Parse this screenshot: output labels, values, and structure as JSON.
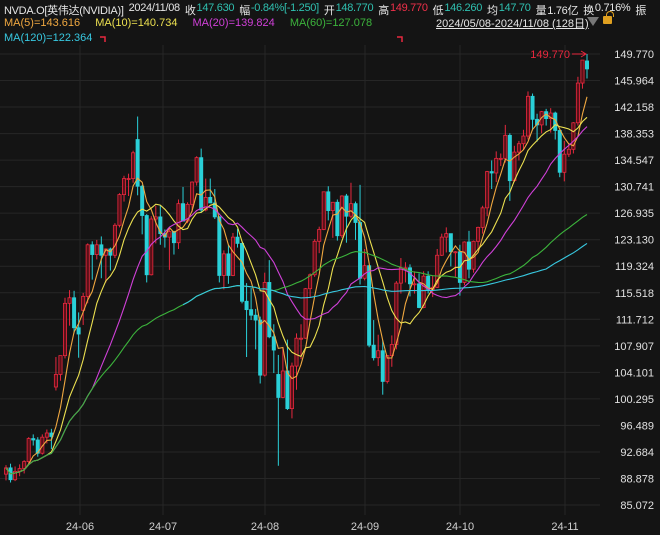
{
  "header": {
    "symbol": "NVDA.O[英伟达(NVIDIA)]",
    "date": "2024/11/08",
    "close_label": "收",
    "close": "147.630",
    "change_label": "幅",
    "change": "-0.84%[-1.250]",
    "open_label": "开",
    "open": "148.770",
    "high_label": "高",
    "high": "149.770",
    "low_label": "低",
    "low": "146.260",
    "avg_label": "均",
    "avg": "147.70",
    "volume_label": "量",
    "volume": "1.76亿",
    "turnover_label": "换",
    "turnover": "0.716%",
    "amplitude_label": "振",
    "range": "2024/05/08-2024/11/08 (128日)",
    "icons": {
      "dropdown": "triangle-down-icon",
      "lock": "unlock-icon"
    }
  },
  "ma_legend": {
    "ma5": "MA(5)=143.616",
    "ma10": "MA(10)=140.734",
    "ma20": "MA(20)=139.824",
    "ma60": "MA(60)=127.078",
    "ma120": "MA(120)=122.364"
  },
  "colors": {
    "up": "#e8283e",
    "down": "#2ad0d8",
    "ma5": "#f0a840",
    "ma10": "#ece050",
    "ma20": "#d040d8",
    "ma60": "#3cb43c",
    "ma120": "#38c8e0",
    "background": "#141414"
  },
  "chart_data": {
    "type": "candlestick",
    "x_tick_labels": [
      "24-06",
      "24-07",
      "24-08",
      "24-09",
      "24-10",
      "24-11"
    ],
    "y_tick_labels": [
      "149.770",
      "145.964",
      "142.158",
      "138.353",
      "134.547",
      "130.741",
      "126.935",
      "123.130",
      "119.324",
      "115.518",
      "111.712",
      "107.907",
      "104.101",
      "100.295",
      "96.489",
      "92.684",
      "88.878",
      "85.072"
    ],
    "ylim": [
      85.072,
      149.77
    ],
    "max_annotation": "149.770",
    "ma_periods": [
      5,
      10,
      20,
      60,
      120
    ],
    "candles_ohlc": [
      [
        89.5,
        90.8,
        88.6,
        90.4
      ],
      [
        90.4,
        91.0,
        88.3,
        88.7
      ],
      [
        88.7,
        90.6,
        88.5,
        89.9
      ],
      [
        89.9,
        90.9,
        89.2,
        90.3
      ],
      [
        90.3,
        91.5,
        89.6,
        91.3
      ],
      [
        91.3,
        94.8,
        91.0,
        94.6
      ],
      [
        94.6,
        95.2,
        93.6,
        94.4
      ],
      [
        94.4,
        94.8,
        92.0,
        92.5
      ],
      [
        92.5,
        95.2,
        92.3,
        94.8
      ],
      [
        94.8,
        95.9,
        93.9,
        95.4
      ],
      [
        95.4,
        96.0,
        93.1,
        94.9
      ],
      [
        102.0,
        106.3,
        101.5,
        103.8
      ],
      [
        103.8,
        106.5,
        102.9,
        106.5
      ],
      [
        106.5,
        114.8,
        106.1,
        114.0
      ],
      [
        114.0,
        115.9,
        110.8,
        114.8
      ],
      [
        114.8,
        115.8,
        109.7,
        110.5
      ],
      [
        110.5,
        112.7,
        106.2,
        109.6
      ],
      [
        113.0,
        115.5,
        110.9,
        115.0
      ],
      [
        115.0,
        122.6,
        114.0,
        122.4
      ],
      [
        122.4,
        122.9,
        117.4,
        121.0
      ],
      [
        121.0,
        123.1,
        120.3,
        122.4
      ],
      [
        122.4,
        123.6,
        117.6,
        120.9
      ],
      [
        120.9,
        121.9,
        117.0,
        121.8
      ],
      [
        121.8,
        122.0,
        118.7,
        120.9
      ],
      [
        120.9,
        125.5,
        120.5,
        125.2
      ],
      [
        125.2,
        129.8,
        124.9,
        129.6
      ],
      [
        129.6,
        132.3,
        128.6,
        131.9
      ],
      [
        131.9,
        132.6,
        129.4,
        131.9
      ],
      [
        131.9,
        135.9,
        131.3,
        135.6
      ],
      [
        137.5,
        140.8,
        129.5,
        130.8
      ],
      [
        130.8,
        131.0,
        123.9,
        126.6
      ],
      [
        126.6,
        126.8,
        117.0,
        118.1
      ],
      [
        118.1,
        126.5,
        118.0,
        126.1
      ],
      [
        126.1,
        128.0,
        122.6,
        126.4
      ],
      [
        126.4,
        128.1,
        122.4,
        124.0
      ],
      [
        124.0,
        124.6,
        122.0,
        123.5
      ],
      [
        123.5,
        124.8,
        118.8,
        124.3
      ],
      [
        124.3,
        124.4,
        121.0,
        122.7
      ],
      [
        122.7,
        128.9,
        121.8,
        128.3
      ],
      [
        128.3,
        130.7,
        125.8,
        125.8
      ],
      [
        125.8,
        128.5,
        125.5,
        128.2
      ],
      [
        128.2,
        131.5,
        127.1,
        131.4
      ],
      [
        131.4,
        135.1,
        130.9,
        134.9
      ],
      [
        134.9,
        136.2,
        127.0,
        127.4
      ],
      [
        127.4,
        131.9,
        127.2,
        129.2
      ],
      [
        129.2,
        131.9,
        128.7,
        128.4
      ],
      [
        128.4,
        130.4,
        126.1,
        126.4
      ],
      [
        126.4,
        126.5,
        117.0,
        118.0
      ],
      [
        118.0,
        121.6,
        116.0,
        121.1
      ],
      [
        121.1,
        122.4,
        116.8,
        118.0
      ],
      [
        118.0,
        124.1,
        117.9,
        123.5
      ],
      [
        123.5,
        124.7,
        122.0,
        122.6
      ],
      [
        122.6,
        122.7,
        114.0,
        114.3
      ],
      [
        114.3,
        116.9,
        106.3,
        113.1
      ],
      [
        113.1,
        116.2,
        111.6,
        112.3
      ],
      [
        112.3,
        113.2,
        107.4,
        111.6
      ],
      [
        111.6,
        112.1,
        102.5,
        103.7
      ],
      [
        103.7,
        118.4,
        103.5,
        117.0
      ],
      [
        117.0,
        120.2,
        109.0,
        109.2
      ],
      [
        109.2,
        111.0,
        104.0,
        107.3
      ],
      [
        103.8,
        106.6,
        90.7,
        100.5
      ],
      [
        100.5,
        107.7,
        100.4,
        104.3
      ],
      [
        104.3,
        108.8,
        98.7,
        98.9
      ],
      [
        98.9,
        105.5,
        97.5,
        105.0
      ],
      [
        105.0,
        109.7,
        101.6,
        109.0
      ],
      [
        109.0,
        111.0,
        106.0,
        109.0
      ],
      [
        109.0,
        116.2,
        108.9,
        116.1
      ],
      [
        116.1,
        118.3,
        114.9,
        118.1
      ],
      [
        118.1,
        123.2,
        117.8,
        122.9
      ],
      [
        122.9,
        125.0,
        121.2,
        124.6
      ],
      [
        124.6,
        130.0,
        124.5,
        130.0
      ],
      [
        130.0,
        130.8,
        125.9,
        127.3
      ],
      [
        127.3,
        128.5,
        123.4,
        128.5
      ],
      [
        128.5,
        128.9,
        123.0,
        123.7
      ],
      [
        123.7,
        129.5,
        123.4,
        129.4
      ],
      [
        129.4,
        129.7,
        122.7,
        126.5
      ],
      [
        126.5,
        131.3,
        126.2,
        128.3
      ],
      [
        128.3,
        128.6,
        123.1,
        125.6
      ],
      [
        125.6,
        131.0,
        116.7,
        117.6
      ],
      [
        117.6,
        121.8,
        117.3,
        119.4
      ],
      [
        119.4,
        119.5,
        107.7,
        108.0
      ],
      [
        108.0,
        111.6,
        105.8,
        106.2
      ],
      [
        106.2,
        109.5,
        105.0,
        107.2
      ],
      [
        107.2,
        108.7,
        100.9,
        102.8
      ],
      [
        102.8,
        106.6,
        102.5,
        106.5
      ],
      [
        106.5,
        109.4,
        104.9,
        108.1
      ],
      [
        108.1,
        117.2,
        107.4,
        116.9
      ],
      [
        116.9,
        120.5,
        115.4,
        119.1
      ],
      [
        119.1,
        119.9,
        117.0,
        119.1
      ],
      [
        119.1,
        119.6,
        115.0,
        116.8
      ],
      [
        116.8,
        118.6,
        115.4,
        116.8
      ],
      [
        116.8,
        118.3,
        113.3,
        113.4
      ],
      [
        113.4,
        118.6,
        113.3,
        117.9
      ],
      [
        117.9,
        118.6,
        115.4,
        116.0
      ],
      [
        116.0,
        118.0,
        114.9,
        116.3
      ],
      [
        116.3,
        121.8,
        116.2,
        120.9
      ],
      [
        120.9,
        124.0,
        120.8,
        123.5
      ],
      [
        123.5,
        124.9,
        121.3,
        124.0
      ],
      [
        124.0,
        124.0,
        119.3,
        121.4
      ],
      [
        121.4,
        121.5,
        117.8,
        121.4
      ],
      [
        121.4,
        122.4,
        115.1,
        117.0
      ],
      [
        117.0,
        122.9,
        116.6,
        122.8
      ],
      [
        122.8,
        124.4,
        117.6,
        118.9
      ],
      [
        118.9,
        123.0,
        118.4,
        122.9
      ],
      [
        122.9,
        125.0,
        121.8,
        124.9
      ],
      [
        124.9,
        128.0,
        124.0,
        127.7
      ],
      [
        127.7,
        133.0,
        126.5,
        132.9
      ],
      [
        132.9,
        134.5,
        130.4,
        132.7
      ],
      [
        132.7,
        135.8,
        131.4,
        134.8
      ],
      [
        134.8,
        135.5,
        133.7,
        134.8
      ],
      [
        134.8,
        139.6,
        134.2,
        138.1
      ],
      [
        138.1,
        138.4,
        128.7,
        131.6
      ],
      [
        131.6,
        136.6,
        131.4,
        135.7
      ],
      [
        135.7,
        137.3,
        134.5,
        136.9
      ],
      [
        136.9,
        138.9,
        136.0,
        138.0
      ],
      [
        138.0,
        144.4,
        137.5,
        143.7
      ],
      [
        143.7,
        144.1,
        138.8,
        140.4
      ],
      [
        140.4,
        141.2,
        137.2,
        139.6
      ],
      [
        139.6,
        141.6,
        138.4,
        141.5
      ],
      [
        141.5,
        141.9,
        139.5,
        140.5
      ],
      [
        140.5,
        142.0,
        138.5,
        141.3
      ],
      [
        141.3,
        141.5,
        137.5,
        138.8
      ],
      [
        138.8,
        139.0,
        132.1,
        132.8
      ],
      [
        132.8,
        137.3,
        131.5,
        135.4
      ],
      [
        135.4,
        137.0,
        135.0,
        136.1
      ],
      [
        136.1,
        140.0,
        135.5,
        139.9
      ],
      [
        139.9,
        146.5,
        139.5,
        145.6
      ],
      [
        145.6,
        148.9,
        144.8,
        148.9
      ],
      [
        148.77,
        149.77,
        146.26,
        147.63
      ]
    ]
  }
}
